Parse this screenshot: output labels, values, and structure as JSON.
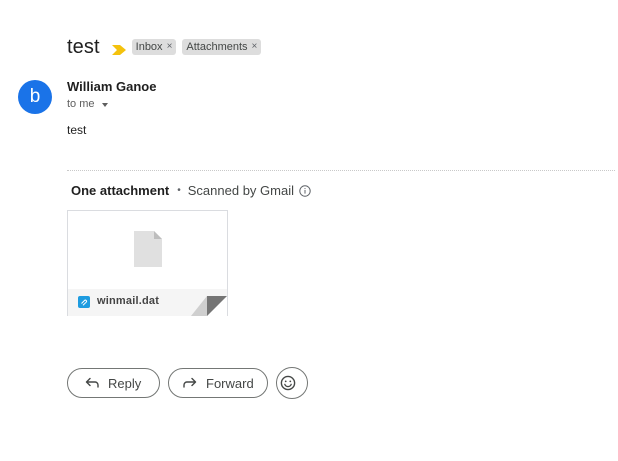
{
  "message": {
    "subject": "test",
    "labels": [
      {
        "name": "Inbox",
        "remove": "×"
      },
      {
        "name": "Attachments",
        "remove": "×"
      }
    ],
    "sender": {
      "avatar_letter": "b",
      "name": "William Ganoe",
      "recipient": "to me"
    },
    "body": "test"
  },
  "attachments": {
    "title": "One attachment",
    "separator": "•",
    "scanned": "Scanned by Gmail",
    "items": [
      {
        "name": "winmail.dat"
      }
    ]
  },
  "actions": {
    "reply": "Reply",
    "forward": "Forward"
  },
  "colors": {
    "avatar": "#1a73e8",
    "importance": "#f4c20d",
    "attachment_icon": "#1e9ce0"
  },
  "icons": {
    "importance": "importance-marker-icon",
    "info": "info-icon",
    "file": "file-icon",
    "reply": "reply-arrow-icon",
    "forward": "forward-arrow-icon",
    "emoji": "emoji-smile-icon"
  }
}
